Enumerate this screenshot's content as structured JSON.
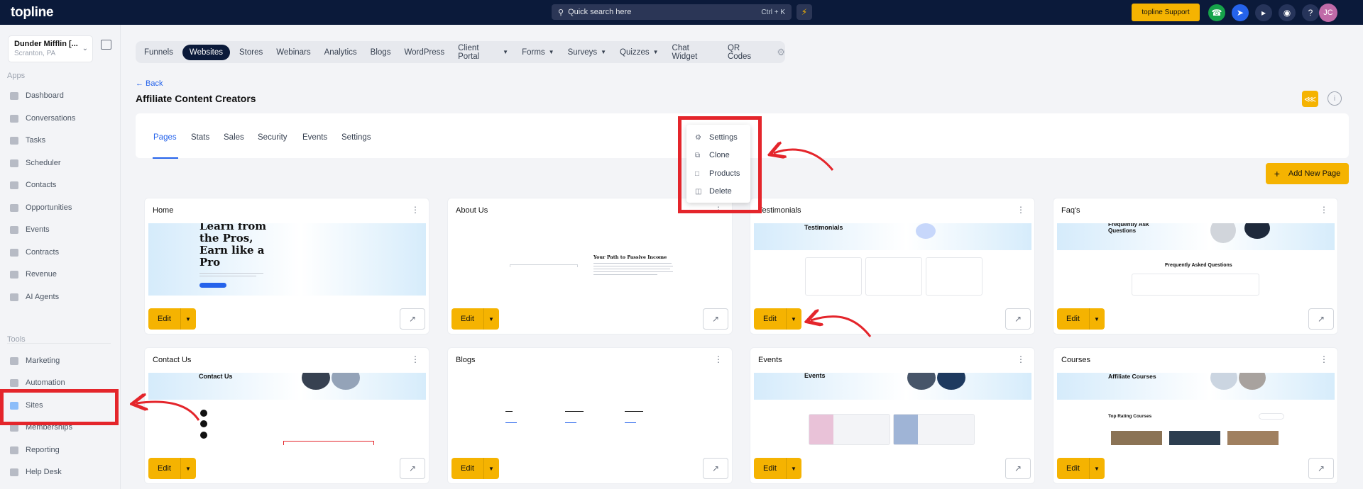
{
  "topbar": {
    "logo": "topline",
    "search_label": "Quick search here",
    "search_shortcut": "Ctrl + K",
    "support_label": "topline Support",
    "avatar_initials": "JC"
  },
  "sidebar": {
    "account_name": "Dunder Mifflin [...",
    "account_location": "Scranton, PA",
    "apps_label": "Apps",
    "apps": [
      "Dashboard",
      "Conversations",
      "Tasks",
      "Scheduler",
      "Contacts",
      "Opportunities",
      "Events",
      "Contracts",
      "Revenue",
      "AI Agents"
    ],
    "tools_label": "Tools",
    "tools": [
      "Marketing",
      "Automation",
      "Sites",
      "Memberships",
      "Reporting",
      "Help Desk"
    ]
  },
  "top_tabs": [
    "Funnels",
    "Websites",
    "Stores",
    "Webinars",
    "Analytics",
    "Blogs",
    "WordPress",
    "Client Portal",
    "Forms",
    "Surveys",
    "Quizzes",
    "Chat Widget",
    "QR Codes"
  ],
  "back_label": "← Back",
  "page_title": "Affiliate Content Creators",
  "page_tabs": [
    "Pages",
    "Stats",
    "Sales",
    "Security",
    "Events",
    "Settings"
  ],
  "add_new_label": "Add New Page",
  "context_menu": [
    "Settings",
    "Clone",
    "Products",
    "Delete"
  ],
  "edit_label": "Edit",
  "cards": [
    "Home",
    "About Us",
    "Testimonials",
    "Faq's",
    "Contact Us",
    "Blogs",
    "Events",
    "Courses"
  ],
  "previews": {
    "home_heading": [
      "Learn from",
      "the Pros,",
      "Earn like a",
      "Pro"
    ],
    "about_heading": "Your Path to Passive Income",
    "testimonials_heading": "Testimonials",
    "faq_top": "Frequently Ask Questions",
    "faq_heading": "Frequently Asked Questions",
    "contact_heading": "Contact Us",
    "events_heading": "Events",
    "courses_heading": "Affiliate Courses",
    "courses_sub": "Top Rating Courses"
  },
  "colors": {
    "accent": "#f5b301",
    "nav_dark": "#0b1a3a",
    "link": "#2563eb",
    "highlight": "#e4252b"
  }
}
